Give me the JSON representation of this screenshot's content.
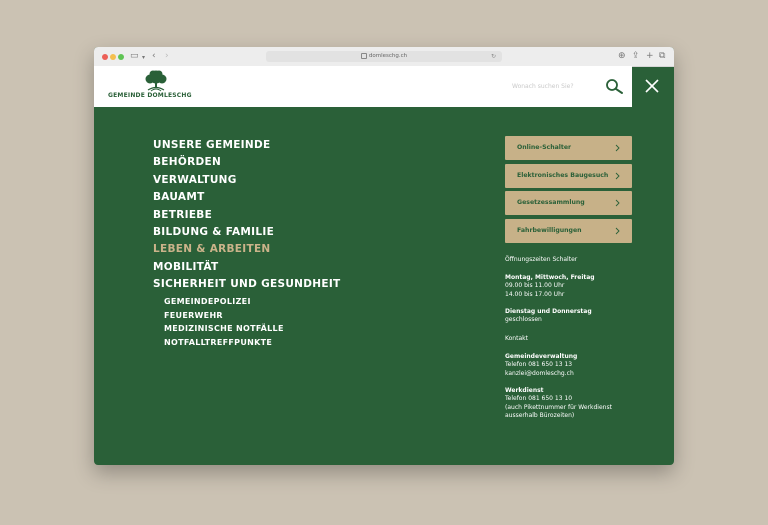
{
  "browser": {
    "url": "domleschg.ch"
  },
  "header": {
    "logo_text": "GEMEINDE DOMLESCHG",
    "search_placeholder": "Wonach suchen Sie?"
  },
  "menu": {
    "items": [
      {
        "label": "UNSERE GEMEINDE"
      },
      {
        "label": "BEHÖRDEN"
      },
      {
        "label": "VERWALTUNG"
      },
      {
        "label": "BAUAMT"
      },
      {
        "label": "BETRIEBE"
      },
      {
        "label": "BILDUNG & FAMILIE"
      },
      {
        "label": "LEBEN & ARBEITEN"
      },
      {
        "label": "MOBILITÄT"
      },
      {
        "label": "SICHERHEIT UND GESUNDHEIT"
      }
    ],
    "active_item": "LEBEN & ARBEITEN",
    "subitems": [
      {
        "label": "GEMEINDEPOLIZEI"
      },
      {
        "label": "FEUERWEHR"
      },
      {
        "label": "MEDIZINISCHE NOTFÄLLE"
      },
      {
        "label": "NOTFALLTREFFPUNKTE"
      }
    ]
  },
  "quick_links": [
    {
      "label": "Online-Schalter"
    },
    {
      "label": "Elektronisches Baugesuch"
    },
    {
      "label": "Gesetzessammlung"
    },
    {
      "label": "Fahrbewilligungen"
    }
  ],
  "info": {
    "hours_title": "Öffnungszeiten Schalter",
    "days1": "Montag, Mittwoch, Freitag",
    "time1": "09.00 bis 11.00 Uhr",
    "time2": "14.00 bis 17.00 Uhr",
    "days2": "Dienstag und Donnerstag",
    "closed": "geschlossen",
    "contact_title": "Kontakt",
    "admin_title": "Gemeindeverwaltung",
    "admin_phone": "Telefon 081 650 13 13",
    "admin_email": "kanzlei@domleschg.ch",
    "works_title": "Werkdienst",
    "works_phone": "Telefon 081 650 13 10",
    "works_note1": "(auch Pikettnummer für Werkdienst",
    "works_note2": "ausserhalb Bürozeiten)"
  },
  "colors": {
    "brand_green": "#2a6038",
    "accent_beige": "#c7b188",
    "active_text": "#cbb38a",
    "page_background": "#cbc2b3"
  }
}
